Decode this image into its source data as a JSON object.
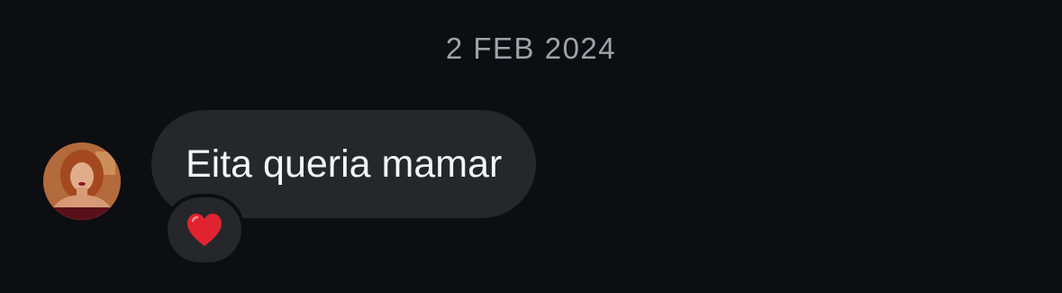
{
  "conversation": {
    "date_divider": "2 FEB 2024"
  },
  "message": {
    "text": "Eita queria mamar",
    "reaction": {
      "icon": "red-heart-icon",
      "color": "#e0242f"
    }
  },
  "colors": {
    "background": "#0c0e12",
    "bubble": "#25272b",
    "text": "#f4f5f7",
    "date": "#9ea3ab"
  }
}
